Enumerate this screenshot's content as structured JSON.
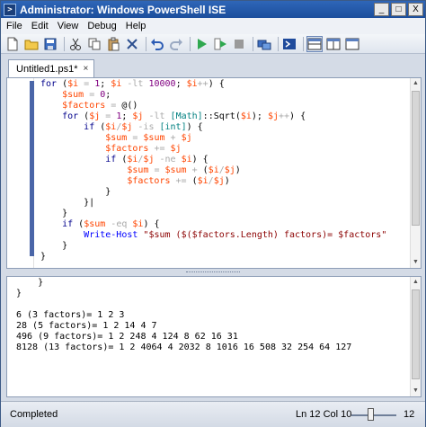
{
  "window": {
    "title": "Administrator: Windows PowerShell ISE",
    "minimize_glyph": "_",
    "maximize_glyph": "□",
    "close_glyph": "X"
  },
  "menu": [
    "File",
    "Edit",
    "View",
    "Debug",
    "Help"
  ],
  "toolbar": {
    "icons": [
      "new-file-icon",
      "open-folder-icon",
      "save-icon",
      "cut-icon",
      "copy-icon",
      "paste-icon",
      "clear-icon",
      "undo-icon",
      "redo-icon",
      "run-icon",
      "run-selection-icon",
      "stop-icon",
      "remote-tab-icon",
      "powershell-icon",
      "layout-top-icon",
      "layout-right-icon",
      "layout-max-icon"
    ]
  },
  "tab": {
    "label": "Untitled1.ps1*",
    "close_glyph": "×"
  },
  "editor": {
    "lines": [
      [
        [
          "kw",
          "for"
        ],
        [
          "par",
          " ("
        ],
        [
          "var",
          "$i"
        ],
        [
          "op",
          " = "
        ],
        [
          "num",
          "1"
        ],
        [
          "par",
          "; "
        ],
        [
          "var",
          "$i"
        ],
        [
          "op",
          " -lt "
        ],
        [
          "num",
          "10000"
        ],
        [
          "par",
          "; "
        ],
        [
          "var",
          "$i"
        ],
        [
          "op",
          "++"
        ],
        [
          "par",
          ") {"
        ]
      ],
      [
        [
          "par",
          "    "
        ],
        [
          "var",
          "$sum"
        ],
        [
          "op",
          " = "
        ],
        [
          "num",
          "0"
        ],
        [
          "par",
          ";"
        ]
      ],
      [
        [
          "par",
          "    "
        ],
        [
          "var",
          "$factors"
        ],
        [
          "op",
          " = "
        ],
        [
          "par",
          "@()"
        ]
      ],
      [
        [
          "par",
          "    "
        ],
        [
          "kw",
          "for"
        ],
        [
          "par",
          " ("
        ],
        [
          "var",
          "$j"
        ],
        [
          "op",
          " = "
        ],
        [
          "num",
          "1"
        ],
        [
          "par",
          "; "
        ],
        [
          "var",
          "$j"
        ],
        [
          "op",
          " -lt "
        ],
        [
          "typ",
          "[Math]"
        ],
        [
          "par",
          "::"
        ],
        [
          "prop",
          "Sqrt"
        ],
        [
          "par",
          "("
        ],
        [
          "var",
          "$i"
        ],
        [
          "par",
          "); "
        ],
        [
          "var",
          "$j"
        ],
        [
          "op",
          "++"
        ],
        [
          "par",
          ") {"
        ]
      ],
      [
        [
          "par",
          "        "
        ],
        [
          "kw",
          "if"
        ],
        [
          "par",
          " ("
        ],
        [
          "var",
          "$i"
        ],
        [
          "op",
          "/"
        ],
        [
          "var",
          "$j"
        ],
        [
          "op",
          " -is "
        ],
        [
          "typ",
          "[int]"
        ],
        [
          "par",
          ") {"
        ]
      ],
      [
        [
          "par",
          "            "
        ],
        [
          "var",
          "$sum"
        ],
        [
          "op",
          " = "
        ],
        [
          "var",
          "$sum"
        ],
        [
          "op",
          " + "
        ],
        [
          "var",
          "$j"
        ]
      ],
      [
        [
          "par",
          "            "
        ],
        [
          "var",
          "$factors"
        ],
        [
          "op",
          " += "
        ],
        [
          "var",
          "$j"
        ]
      ],
      [
        [
          "par",
          "            "
        ],
        [
          "kw",
          "if"
        ],
        [
          "par",
          " ("
        ],
        [
          "var",
          "$i"
        ],
        [
          "op",
          "/"
        ],
        [
          "var",
          "$j"
        ],
        [
          "op",
          " -ne "
        ],
        [
          "var",
          "$i"
        ],
        [
          "par",
          ") {"
        ]
      ],
      [
        [
          "par",
          "                "
        ],
        [
          "var",
          "$sum"
        ],
        [
          "op",
          " = "
        ],
        [
          "var",
          "$sum"
        ],
        [
          "op",
          " + "
        ],
        [
          "par",
          "("
        ],
        [
          "var",
          "$i"
        ],
        [
          "op",
          "/"
        ],
        [
          "var",
          "$j"
        ],
        [
          "par",
          ")"
        ]
      ],
      [
        [
          "par",
          "                "
        ],
        [
          "var",
          "$factors"
        ],
        [
          "op",
          " += "
        ],
        [
          "par",
          "("
        ],
        [
          "var",
          "$i"
        ],
        [
          "op",
          "/"
        ],
        [
          "var",
          "$j"
        ],
        [
          "par",
          ")"
        ]
      ],
      [
        [
          "par",
          "            }"
        ]
      ],
      [
        [
          "par",
          "        }|"
        ]
      ],
      [
        [
          "par",
          "    }"
        ]
      ],
      [
        [
          "par",
          "    "
        ],
        [
          "kw",
          "if"
        ],
        [
          "par",
          " ("
        ],
        [
          "var",
          "$sum"
        ],
        [
          "op",
          " -eq "
        ],
        [
          "var",
          "$i"
        ],
        [
          "par",
          ") {"
        ]
      ],
      [
        [
          "par",
          "        "
        ],
        [
          "cmd",
          "Write-Host"
        ],
        [
          "par",
          " "
        ],
        [
          "str",
          "\"$sum ($($factors.Length) factors)= $factors\""
        ]
      ],
      [
        [
          "par",
          "    }"
        ]
      ],
      [
        [
          "par",
          "}"
        ]
      ]
    ]
  },
  "output": {
    "lines": [
      "    }",
      "}",
      "",
      "6 (3 factors)= 1 2 3",
      "28 (5 factors)= 1 2 14 4 7",
      "496 (9 factors)= 1 2 248 4 124 8 62 16 31",
      "8128 (13 factors)= 1 2 4064 4 2032 8 1016 16 508 32 254 64 127"
    ]
  },
  "status": {
    "text": "Completed",
    "position": "Ln 12  Col 10",
    "zoom": "12"
  },
  "colors": {
    "keyword": "#00008b",
    "variable": "#ff4500",
    "number": "#800080",
    "string": "#8b0000",
    "operator": "#a9a9a9",
    "type": "#008080",
    "command": "#0000ff"
  }
}
